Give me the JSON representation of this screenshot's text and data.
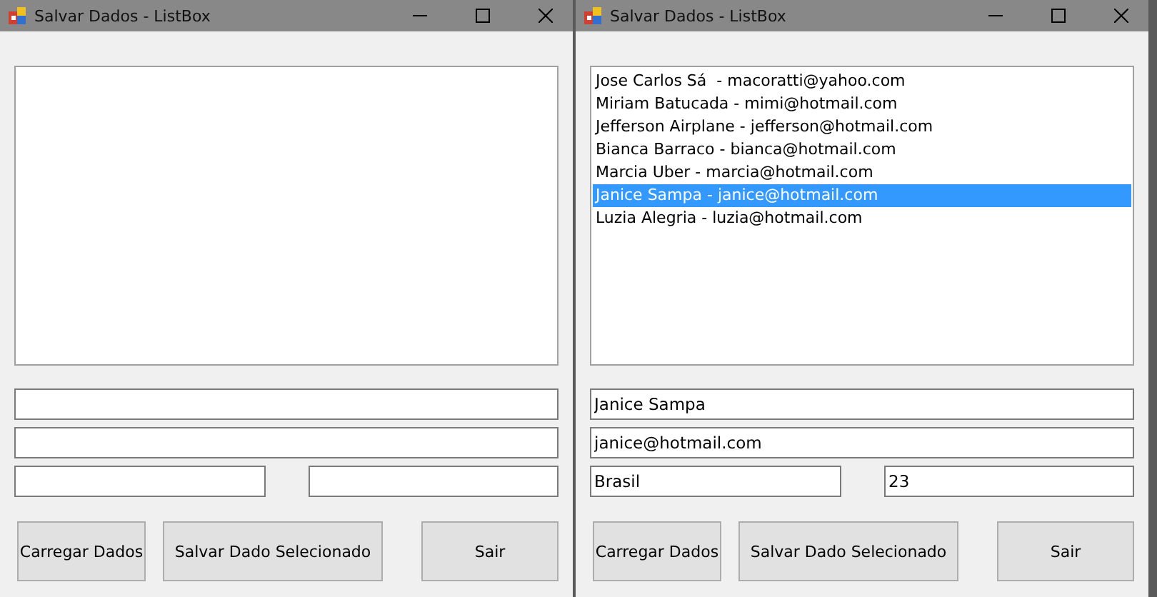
{
  "windows": [
    {
      "title": "Salvar Dados - ListBox",
      "fields": [
        {
          "kind": "wide"
        },
        {
          "kind": "wide"
        },
        {
          "kind": "half"
        },
        {
          "kind": "half"
        }
      ],
      "buttons": [
        "Carregar Dados",
        "Salvar Dado Selecionado",
        "Sair"
      ]
    },
    {
      "title": "Salvar Dados - ListBox",
      "list": [
        {
          "text": "Jose Carlos Sá  - macoratti@yahoo.com",
          "selected": false
        },
        {
          "text": "Miriam Batucada - mimi@hotmail.com",
          "selected": false
        },
        {
          "text": "Jefferson Airplane - jefferson@hotmail.com",
          "selected": false
        },
        {
          "text": "Bianca Barraco - bianca@hotmail.com",
          "selected": false
        },
        {
          "text": "Marcia Uber - marcia@hotmail.com",
          "selected": false
        },
        {
          "text": "Janice Sampa - janice@hotmail.com",
          "selected": true
        },
        {
          "text": "Luzia Alegria - luzia@hotmail.com",
          "selected": false
        }
      ],
      "fields": [
        {
          "kind": "wide",
          "value": "Janice Sampa"
        },
        {
          "kind": "wide",
          "value": "janice@hotmail.com"
        },
        {
          "kind": "half",
          "value": "Brasil"
        },
        {
          "kind": "half",
          "value": "23"
        }
      ],
      "buttons": [
        "Carregar Dados",
        "Salvar Dado Selecionado",
        "Sair"
      ]
    }
  ]
}
